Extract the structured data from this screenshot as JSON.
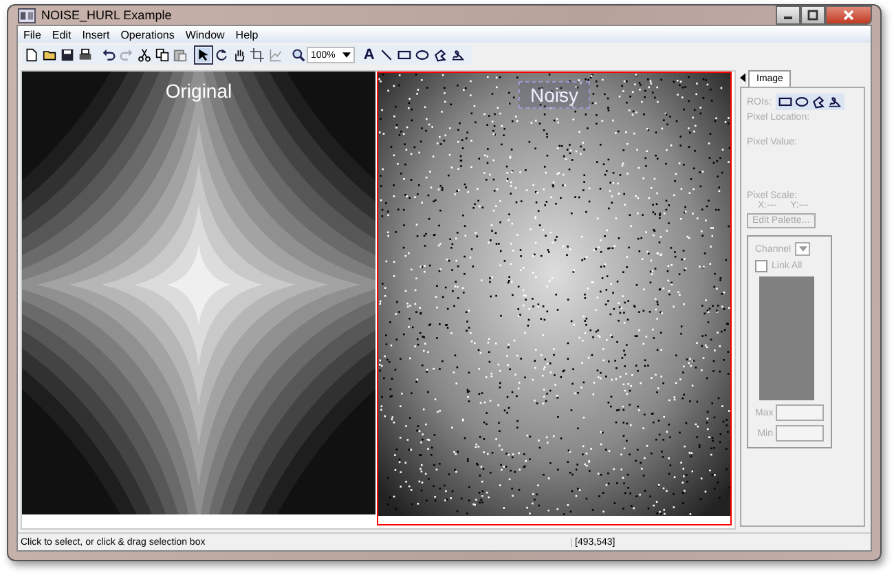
{
  "window": {
    "title": "NOISE_HURL Example"
  },
  "menu": [
    "File",
    "Edit",
    "Insert",
    "Operations",
    "Window",
    "Help"
  ],
  "toolbar": [
    {
      "kind": "new",
      "selected": false
    },
    {
      "kind": "open",
      "selected": false
    },
    {
      "kind": "save",
      "selected": false
    },
    {
      "kind": "print",
      "selected": false
    },
    {
      "kind": "sep"
    },
    {
      "kind": "undo",
      "selected": false
    },
    {
      "kind": "redo",
      "selected": false
    },
    {
      "kind": "cut",
      "selected": false
    },
    {
      "kind": "copy",
      "selected": false
    },
    {
      "kind": "paste",
      "selected": false
    },
    {
      "kind": "sep"
    },
    {
      "kind": "pointer",
      "selected": true
    },
    {
      "kind": "rotate",
      "selected": false
    },
    {
      "kind": "hand",
      "selected": false
    },
    {
      "kind": "crop",
      "selected": false
    },
    {
      "kind": "axes",
      "selected": false
    },
    {
      "kind": "sep"
    },
    {
      "kind": "zoom",
      "selected": false
    }
  ],
  "zoom": {
    "value": "100%"
  },
  "draw_tools": [
    {
      "kind": "text",
      "label": "A"
    },
    {
      "kind": "line"
    },
    {
      "kind": "rect"
    },
    {
      "kind": "ellipse"
    },
    {
      "kind": "polygon"
    },
    {
      "kind": "freehand"
    }
  ],
  "images": [
    {
      "kind": "gradient",
      "label": "Original",
      "selected": false
    },
    {
      "kind": "noisy",
      "label": "Noisy",
      "selected": true
    }
  ],
  "panel": {
    "tab": {
      "label": "Image",
      "selected": true
    },
    "disabled": true,
    "roi_label": "ROIs:",
    "roi_tools": [
      {
        "kind": "rect"
      },
      {
        "kind": "ellipse"
      },
      {
        "kind": "polygon"
      },
      {
        "kind": "freehand"
      }
    ],
    "pixel_location": "Pixel Location:",
    "pixel_value": "Pixel Value:",
    "pixel_scale": "Pixel Scale:",
    "x_label": "X:---",
    "y_label": "Y:---",
    "edit_palette": "Edit Palette...",
    "channel_label": "Channel",
    "link_all": {
      "label": "Link All",
      "checked": false
    },
    "max_label": "Max",
    "min_label": "Min"
  },
  "status_bar": {
    "message": "Click to select, or click & drag selection box",
    "coords": "[493,543]"
  }
}
